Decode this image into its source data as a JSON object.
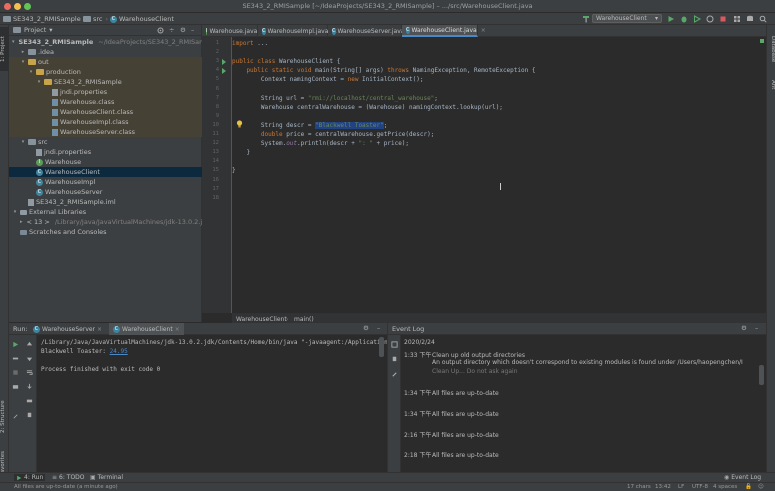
{
  "window": {
    "title": "SE343_2_RMISample [~/IdeaProjects/SE343_2_RMISample] – .../src/WarehouseClient.java"
  },
  "navbar": {
    "crumbs": [
      "SE343_2_RMISample",
      "src",
      "WarehouseClient"
    ],
    "run_config": "WarehouseClient"
  },
  "side_tabs": {
    "left": [
      "1: Project",
      "2: Structure",
      "2: Favorites"
    ],
    "right": [
      "Database",
      "Ant"
    ]
  },
  "project": {
    "header": "Project",
    "tree": [
      {
        "label": "SE343_2_RMISample",
        "hint": "~/IdeaProjects/SE343_2_RMISample",
        "indent": 0,
        "arrow": "▾",
        "icon": "folder",
        "bold": true
      },
      {
        "label": ".idea",
        "indent": 1,
        "arrow": "▸",
        "icon": "folder"
      },
      {
        "label": "out",
        "indent": 1,
        "arrow": "▾",
        "icon": "folder-excluded"
      },
      {
        "label": "production",
        "indent": 2,
        "arrow": "▾",
        "icon": "folder-excluded"
      },
      {
        "label": "SE343_2_RMISample",
        "indent": 3,
        "arrow": "▾",
        "icon": "folder-excluded"
      },
      {
        "label": "jndi.properties",
        "indent": 4,
        "arrow": "",
        "icon": "file"
      },
      {
        "label": "Warehouse.class",
        "indent": 4,
        "arrow": "",
        "icon": "class-file"
      },
      {
        "label": "WarehouseClient.class",
        "indent": 4,
        "arrow": "",
        "icon": "class-file"
      },
      {
        "label": "WarehouseImpl.class",
        "indent": 4,
        "arrow": "",
        "icon": "class-file"
      },
      {
        "label": "WarehouseServer.class",
        "indent": 4,
        "arrow": "",
        "icon": "class-file"
      },
      {
        "label": "src",
        "indent": 1,
        "arrow": "▾",
        "icon": "folder"
      },
      {
        "label": "jndi.properties",
        "indent": 2,
        "arrow": "",
        "icon": "file"
      },
      {
        "label": "Warehouse",
        "indent": 2,
        "arrow": "",
        "icon": "interface"
      },
      {
        "label": "WarehouseClient",
        "indent": 2,
        "arrow": "",
        "icon": "class",
        "selected": true
      },
      {
        "label": "WarehouseImpl",
        "indent": 2,
        "arrow": "",
        "icon": "class"
      },
      {
        "label": "WarehouseServer",
        "indent": 2,
        "arrow": "",
        "icon": "class"
      },
      {
        "label": "SE343_2_RMISample.iml",
        "indent": 1,
        "arrow": "",
        "icon": "file"
      },
      {
        "label": "External Libraries",
        "indent": 0,
        "arrow": "▾",
        "icon": "library"
      },
      {
        "label": "< 13 >",
        "hint": "/Library/Java/JavaVirtualMachines/jdk-13.0.2.jdk",
        "indent": 1,
        "arrow": "▸",
        "icon": "library"
      },
      {
        "label": "Scratches and Consoles",
        "indent": 0,
        "arrow": "",
        "icon": "scratch"
      }
    ]
  },
  "editor": {
    "tabs": [
      {
        "label": "Warehouse.java",
        "active": false
      },
      {
        "label": "WarehouseImpl.java",
        "active": false
      },
      {
        "label": "WarehouseServer.java",
        "active": false
      },
      {
        "label": "WarehouseClient.java",
        "active": true
      }
    ],
    "line_numbers": [
      "1",
      "2",
      "3",
      "4",
      "5",
      "6",
      "7",
      "8",
      "9",
      "10",
      "11",
      "12",
      "13",
      "14",
      "15",
      "16",
      "17",
      "18"
    ],
    "lines": [
      [
        {
          "t": "import ",
          "c": "kw"
        },
        {
          "t": "...",
          "c": "cls"
        }
      ],
      [],
      [
        {
          "t": "public class ",
          "c": "kw"
        },
        {
          "t": "WarehouseClient {",
          "c": "cls"
        }
      ],
      [
        {
          "t": "    public static void ",
          "c": "kw"
        },
        {
          "t": "main(String[] args) ",
          "c": "cls"
        },
        {
          "t": "throws ",
          "c": "kw"
        },
        {
          "t": "NamingException, RemoteException {",
          "c": "cls"
        }
      ],
      [
        {
          "t": "        Context namingContext = ",
          "c": "cls"
        },
        {
          "t": "new ",
          "c": "kw"
        },
        {
          "t": "InitialContext();",
          "c": "cls"
        }
      ],
      [],
      [
        {
          "t": "        String url = ",
          "c": "cls"
        },
        {
          "t": "\"rmi://localhost/central_warehouse\"",
          "c": "str"
        },
        {
          "t": ";",
          "c": "cls"
        }
      ],
      [
        {
          "t": "        Warehouse centralWarehouse = (Warehouse) namingContext.lookup(url);",
          "c": "cls"
        }
      ],
      [],
      [
        {
          "t": "        String descr = ",
          "c": "cls"
        },
        {
          "t": "\"Blackwell Toaster\"",
          "c": "str sel-str"
        },
        {
          "t": ";",
          "c": "cls"
        }
      ],
      [
        {
          "t": "        double ",
          "c": "kw"
        },
        {
          "t": "price = centralWarehouse.getPrice(descr);",
          "c": "cls"
        }
      ],
      [
        {
          "t": "        System.",
          "c": "cls"
        },
        {
          "t": "out",
          "c": "fld"
        },
        {
          "t": ".println(descr + ",
          "c": "cls"
        },
        {
          "t": "\": \"",
          "c": "str"
        },
        {
          "t": " + price);",
          "c": "cls"
        }
      ],
      [
        {
          "t": "    }",
          "c": "cls"
        }
      ],
      [],
      [
        {
          "t": "}",
          "c": "cls"
        }
      ],
      [],
      [],
      []
    ],
    "breadcrumb": [
      "WarehouseClient",
      "main()"
    ]
  },
  "run": {
    "label": "Run:",
    "tabs": [
      {
        "label": "WarehouseServer",
        "active": false
      },
      {
        "label": "WarehouseClient",
        "active": true
      }
    ],
    "console": {
      "cmd": "/Library/Java/JavaVirtualMachines/jdk-13.0.2.jdk/Contents/Home/bin/java \"-javaagent:/Applications/In",
      "output_prefix": "Blackwell Toaster: ",
      "output_value": "24.95",
      "finished": "Process finished with exit code 0"
    }
  },
  "event_log": {
    "title": "Event Log",
    "date": "2020/2/24",
    "entries": [
      {
        "time": "1:33 下午",
        "text": "Clean up old output directories"
      },
      {
        "time": "",
        "text": "An output directory which doesn't correspond to existing modules is found under /Users/haopengchen/I"
      },
      {
        "time": "",
        "text": "Clean Up...   Do not ask again",
        "muted": true
      },
      {
        "time": "1:34 下午",
        "text": "All files are up-to-date"
      },
      {
        "time": "1:34 下午",
        "text": "All files are up-to-date"
      },
      {
        "time": "2:16 下午",
        "text": "All files are up-to-date"
      },
      {
        "time": "2:18 下午",
        "text": "All files are up-to-date"
      }
    ]
  },
  "bottom_tabs": [
    {
      "label": "4: Run",
      "active": true
    },
    {
      "label": "6: TODO",
      "active": false
    },
    {
      "label": "Terminal",
      "active": false
    }
  ],
  "bottom_right_tab": "Event Log",
  "status": {
    "message": "All files are up-to-date (a minute ago)",
    "chars": "17 chars",
    "position": "13:42",
    "line_sep": "LF",
    "encoding": "UTF-8",
    "indent": "4 spaces"
  },
  "colors": {
    "accent": "#4a88c7",
    "keyword": "#cc7832",
    "string": "#6a8759",
    "selection": "#214283",
    "run_green": "#59a869",
    "stop_red": "#db5860"
  }
}
